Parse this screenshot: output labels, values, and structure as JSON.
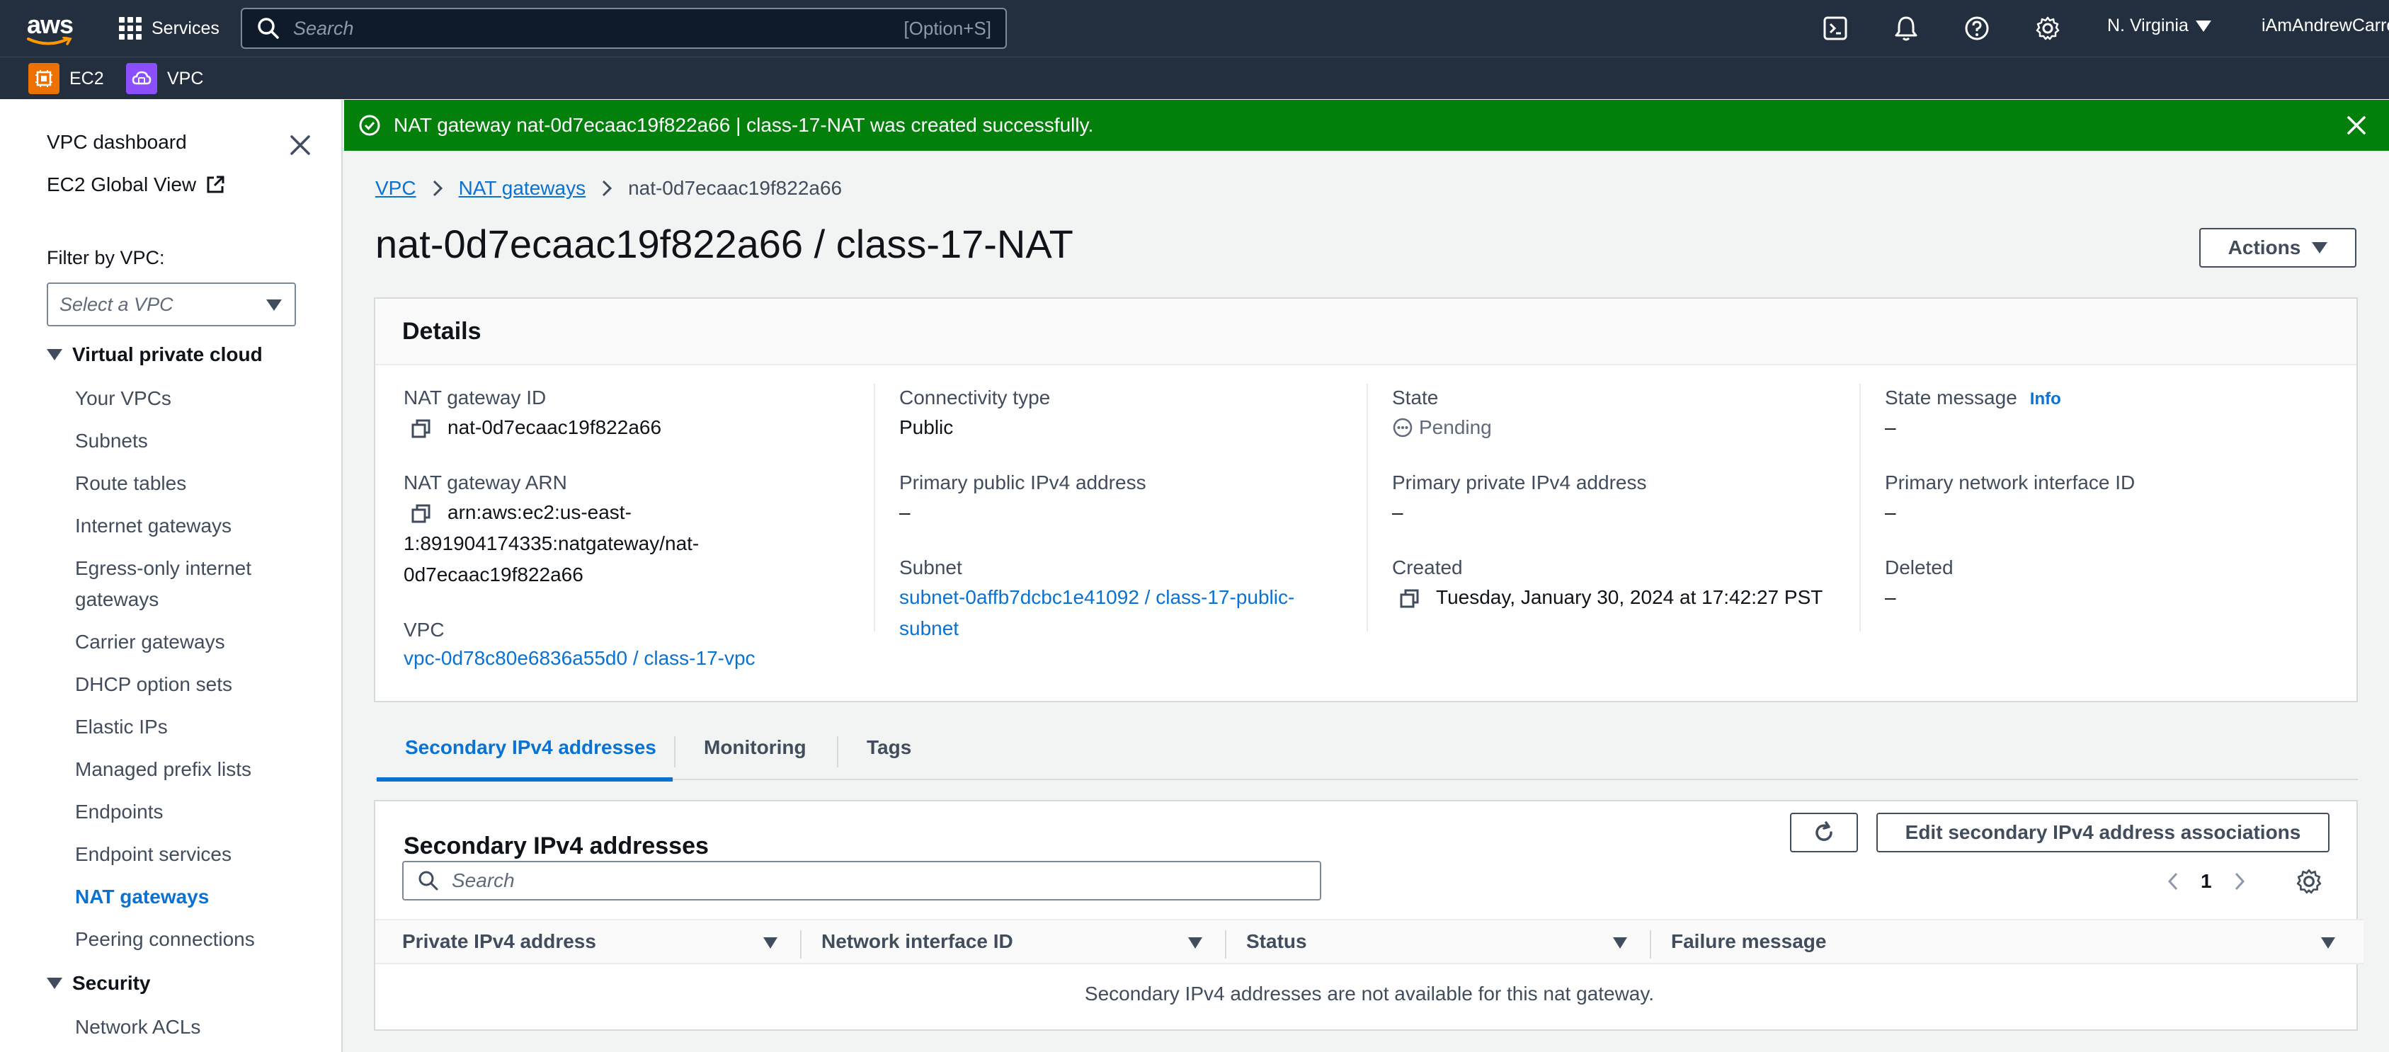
{
  "topnav": {
    "logo_text": "aws",
    "services_label": "Services",
    "search_placeholder": "Search",
    "search_shortcut": "[Option+S]",
    "region": "N. Virginia",
    "account": "iAmAndrewCarroll"
  },
  "favorites": [
    {
      "label": "EC2",
      "color": "#ed7100"
    },
    {
      "label": "VPC",
      "color": "#8c4fff"
    }
  ],
  "sidebar": {
    "top_links": [
      "VPC dashboard",
      "EC2 Global View"
    ],
    "filter_label": "Filter by VPC:",
    "filter_placeholder": "Select a VPC",
    "section_vpc": "Virtual private cloud",
    "items": [
      "Your VPCs",
      "Subnets",
      "Route tables",
      "Internet gateways",
      "Egress-only internet gateways",
      "Carrier gateways",
      "DHCP option sets",
      "Elastic IPs",
      "Managed prefix lists",
      "Endpoints",
      "Endpoint services",
      "NAT gateways",
      "Peering connections"
    ],
    "active_item": "NAT gateways",
    "section_security": "Security",
    "security_items": [
      "Network ACLs"
    ]
  },
  "flash": {
    "message": "NAT gateway nat-0d7ecaac19f822a66 | class-17-NAT was created successfully."
  },
  "breadcrumb": {
    "vpc": "VPC",
    "nat": "NAT gateways",
    "current": "nat-0d7ecaac19f822a66"
  },
  "page": {
    "title": "nat-0d7ecaac19f822a66 / class-17-NAT",
    "actions_label": "Actions"
  },
  "details": {
    "heading": "Details",
    "nat_id_label": "NAT gateway ID",
    "nat_id": "nat-0d7ecaac19f822a66",
    "arn_label": "NAT gateway ARN",
    "arn_line1": "arn:aws:ec2:us-east-",
    "arn_line2": "1:891904174335:natgateway/nat-",
    "arn_line3": "0d7ecaac19f822a66",
    "vpc_label": "VPC",
    "vpc_value": "vpc-0d78c80e6836a55d0 / class-17-vpc",
    "connectivity_label": "Connectivity type",
    "connectivity_value": "Public",
    "public_ip_label": "Primary public IPv4 address",
    "public_ip_value": "–",
    "subnet_label": "Subnet",
    "subnet_line1": "subnet-0affb7dcbc1e41092 / class-17-public-",
    "subnet_line2": "subnet",
    "state_label": "State",
    "state_value": "Pending",
    "private_ip_label": "Primary private IPv4 address",
    "private_ip_value": "–",
    "created_label": "Created",
    "created_value": "Tuesday, January 30, 2024 at 17:42:27 PST",
    "state_msg_label": "State message",
    "info_label": "Info",
    "state_msg_value": "–",
    "eni_label": "Primary network interface ID",
    "eni_value": "–",
    "deleted_label": "Deleted",
    "deleted_value": "–"
  },
  "tabs": [
    "Secondary IPv4 addresses",
    "Monitoring",
    "Tags"
  ],
  "secondary": {
    "title": "Secondary IPv4 addresses",
    "edit_label": "Edit secondary IPv4 address associations",
    "search_placeholder": "Search",
    "page_number": "1",
    "columns": [
      "Private IPv4 address",
      "Network interface ID",
      "Status",
      "Failure message"
    ],
    "empty_message": "Secondary IPv4 addresses are not available for this nat gateway."
  }
}
